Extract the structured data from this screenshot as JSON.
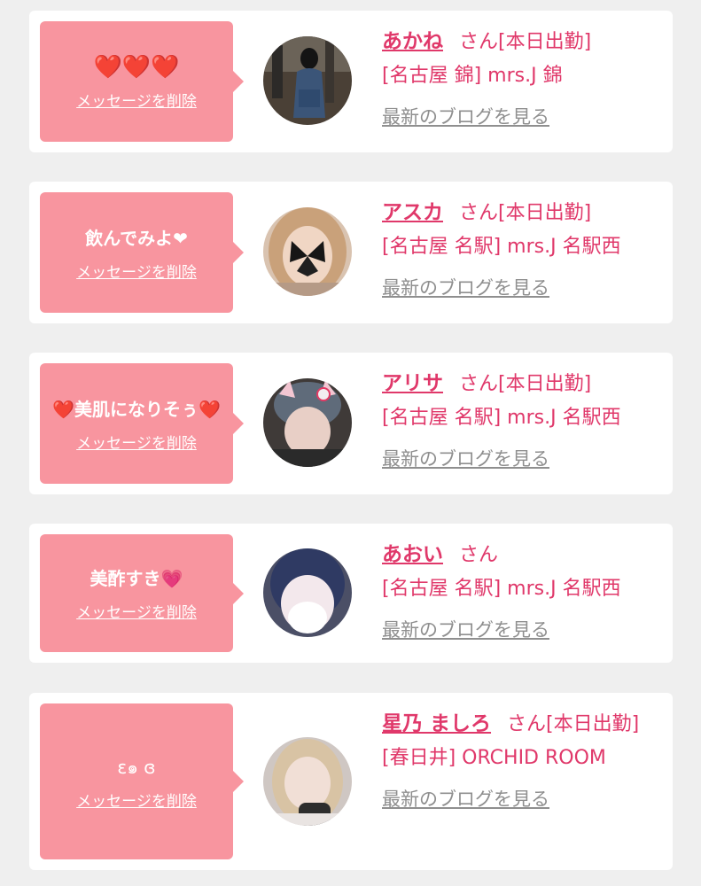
{
  "delete_label": "メッセージを削除",
  "blog_label": "最新のブログを見る",
  "honorific": "さん",
  "colors": {
    "background": "#efefef",
    "bubble": "#f8959f",
    "accent": "#e0386a",
    "link_gray": "#8f8f8f"
  },
  "cards": [
    {
      "message": "❤️❤️❤️",
      "name": "あかね",
      "status": "[本日出勤]",
      "shop": "[名古屋 錦] mrs.J 錦"
    },
    {
      "message": "飲んでみよ❤",
      "name": "アスカ",
      "status": "[本日出勤]",
      "shop": "[名古屋 名駅] mrs.J 名駅西"
    },
    {
      "message": "❤️美肌になりそぅ❤️",
      "name": "アリサ",
      "status": "[本日出勤]",
      "shop": "[名古屋 名駅] mrs.J 名駅西"
    },
    {
      "message": "美酢すき💗",
      "name": "あおい",
      "status": "",
      "shop": "[名古屋 名駅] mrs.J 名駅西"
    },
    {
      "message": "ɛ๑ ɞ",
      "name": "星乃 ましろ",
      "status": "[本日出勤]",
      "shop": "[春日井] ORCHID ROOM"
    }
  ]
}
